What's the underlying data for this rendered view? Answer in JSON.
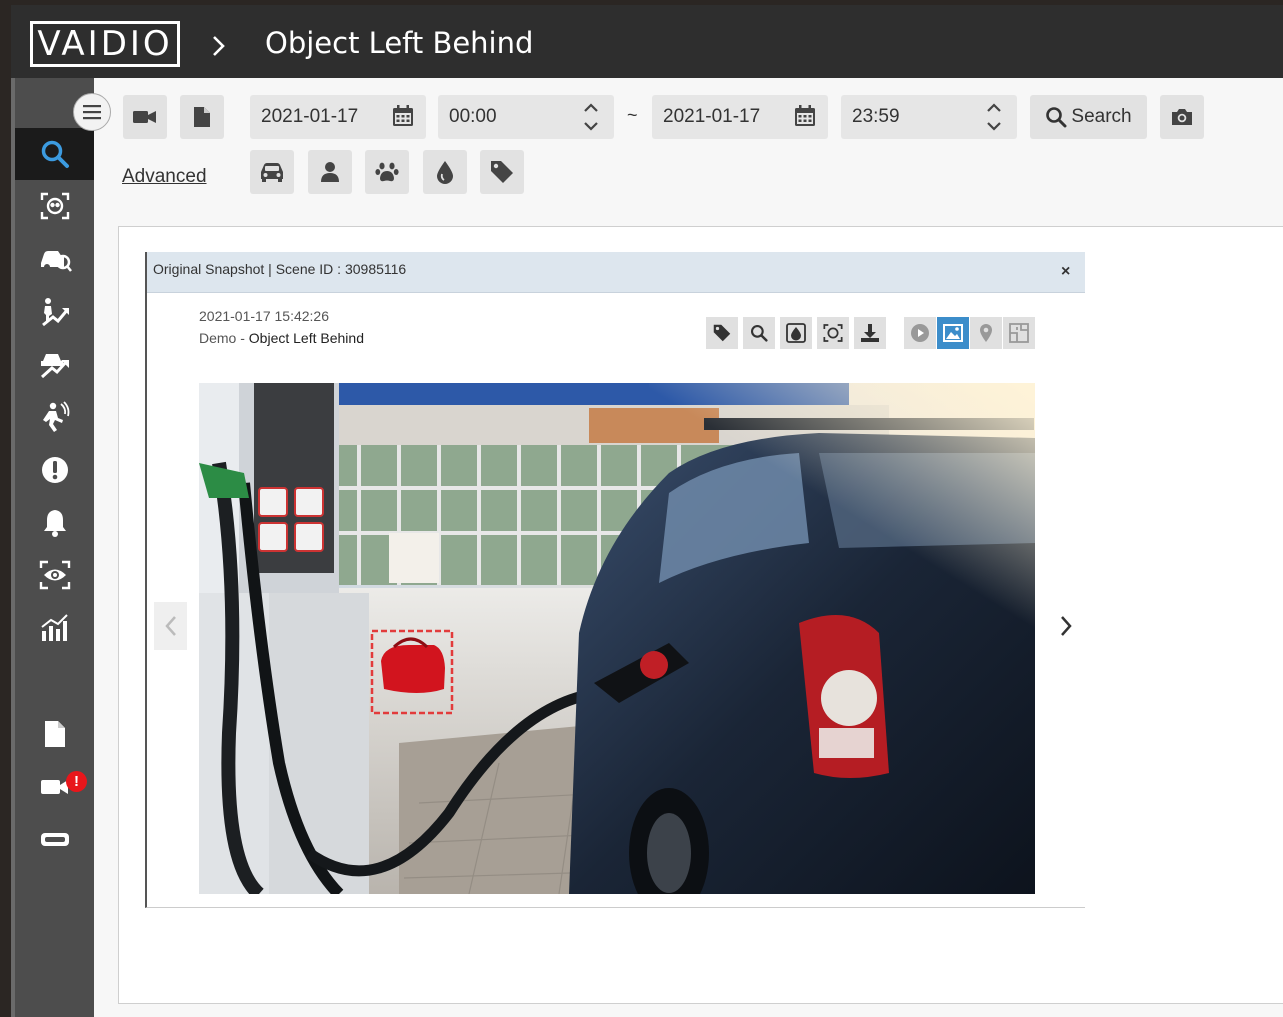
{
  "header": {
    "logo": "VAIDIO",
    "title": "Object Left Behind"
  },
  "sidebar": {
    "items": [
      {
        "icon": "search-icon",
        "active": true
      },
      {
        "icon": "face-search-icon"
      },
      {
        "icon": "vehicle-search-icon"
      },
      {
        "icon": "person-trend-icon"
      },
      {
        "icon": "vehicle-trend-icon"
      },
      {
        "icon": "loitering-icon"
      },
      {
        "icon": "alert-icon"
      },
      {
        "icon": "bell-icon"
      },
      {
        "icon": "eye-monitor-icon"
      },
      {
        "icon": "statistics-icon"
      },
      {
        "icon": "report-icon"
      },
      {
        "icon": "camera-alert-icon",
        "badge": "!"
      },
      {
        "icon": "storage-icon"
      }
    ]
  },
  "filters": {
    "start_date": "2021-01-17",
    "start_time": "00:00",
    "separator": "~",
    "end_date": "2021-01-17",
    "end_time": "23:59",
    "search_label": "Search",
    "advanced_label": "Advanced",
    "object_types": [
      "car-icon",
      "person-icon",
      "paw-icon",
      "color-drop-icon",
      "tag-icon"
    ]
  },
  "snapshot": {
    "title": "Original Snapshot | Scene ID : 30985116",
    "close": "×",
    "timestamp": "2021-01-17 15:42:26",
    "camera_prefix": "Demo - ",
    "camera_name": "Object Left Behind",
    "actions": [
      "tag-icon",
      "zoom-icon",
      "color-icon",
      "face-icon",
      "download-icon"
    ],
    "view_modes": [
      "play-icon",
      "image-icon",
      "map-pin-icon",
      "floorplan-icon"
    ],
    "active_view": "image-icon"
  },
  "colors": {
    "topbar": "#2e2e2e",
    "sidebar": "#4d4d4d",
    "accent": "#3c8dca",
    "detection_box": "#e23b3b",
    "badge": "#e8161b"
  }
}
